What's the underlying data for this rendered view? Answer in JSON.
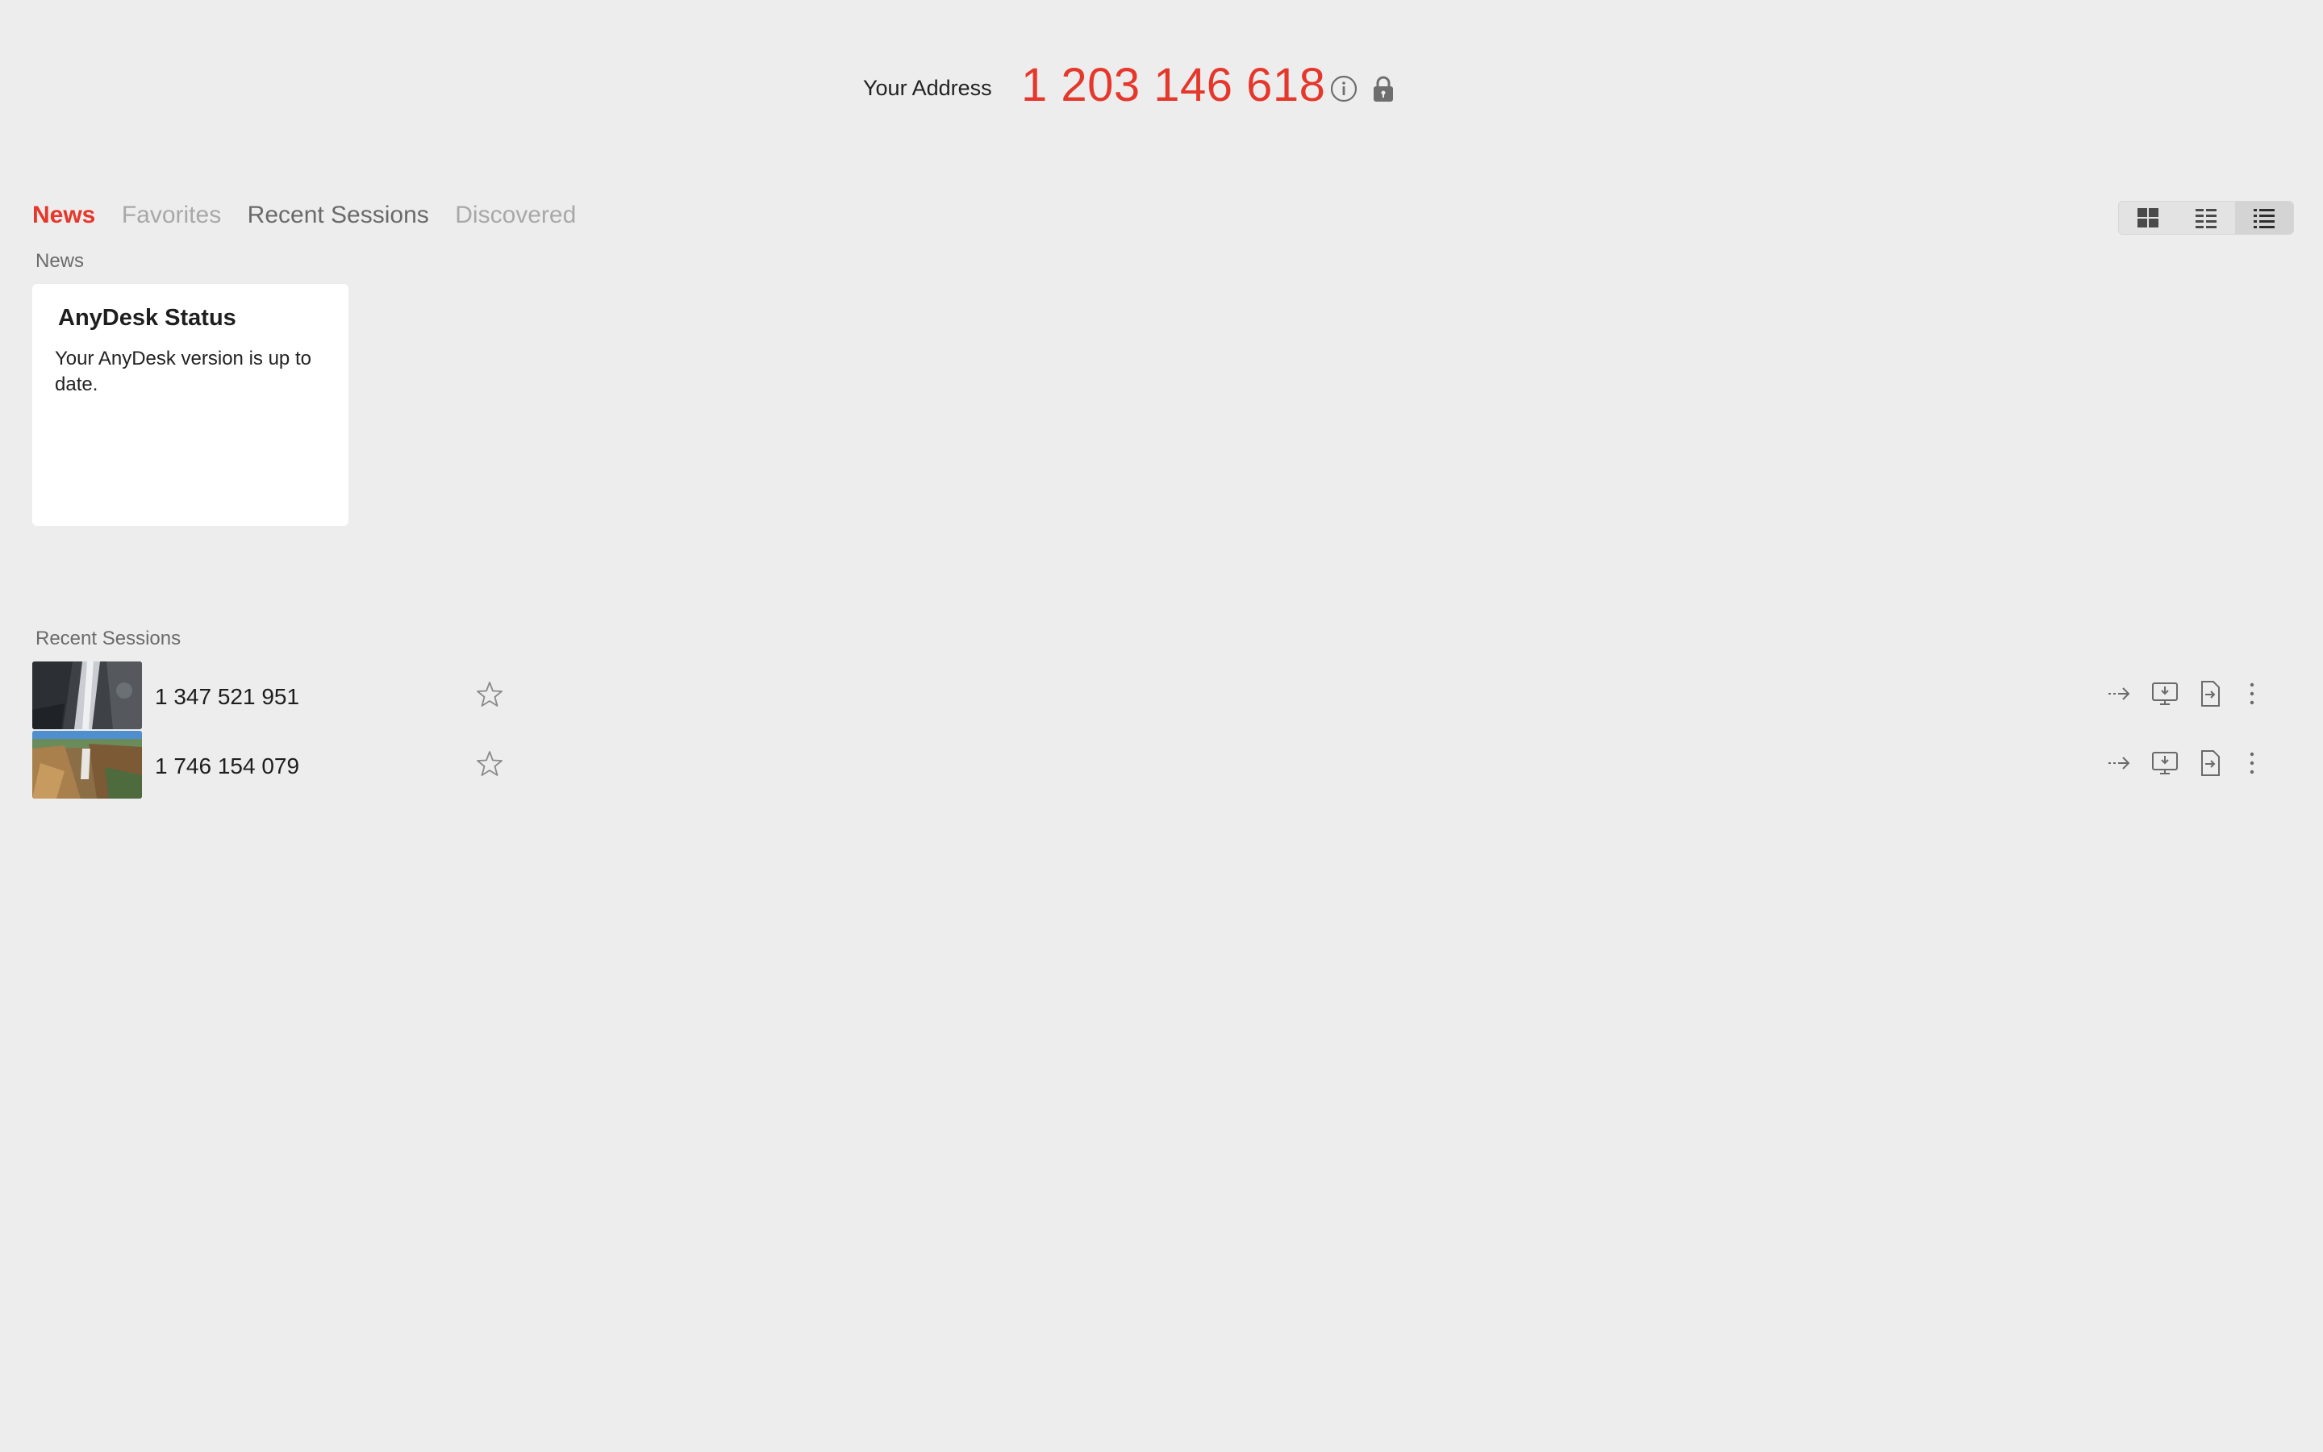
{
  "header": {
    "address_label": "Your Address",
    "address_value": "1 203 146 618",
    "icons": [
      "info-icon",
      "lock-icon"
    ]
  },
  "tabs": [
    {
      "label": "News",
      "state": "active"
    },
    {
      "label": "Favorites",
      "state": "inactive"
    },
    {
      "label": "Recent Sessions",
      "state": "inactive"
    },
    {
      "label": "Discovered",
      "state": "inactive"
    }
  ],
  "view_modes": [
    "tiles-view-icon",
    "details-view-icon",
    "list-view-icon"
  ],
  "view_selected": "list",
  "news": {
    "section_label": "News",
    "card_title": "AnyDesk Status",
    "card_body": "Your AnyDesk version is up to date."
  },
  "recent": {
    "section_label": "Recent Sessions",
    "sessions": [
      {
        "id": "1 347 521 951",
        "thumbnail": "rocky-stream-photo"
      },
      {
        "id": "1 746 154 079",
        "thumbnail": "canyon-landscape-photo"
      }
    ],
    "row_actions": [
      "connect-arrow-icon",
      "remote-desktop-icon",
      "file-transfer-icon",
      "more-options-icon"
    ]
  },
  "colors": {
    "accent": "#e5382c",
    "background": "#ededed",
    "card": "#ffffff",
    "tab_inactive": "#a8a8a8"
  }
}
